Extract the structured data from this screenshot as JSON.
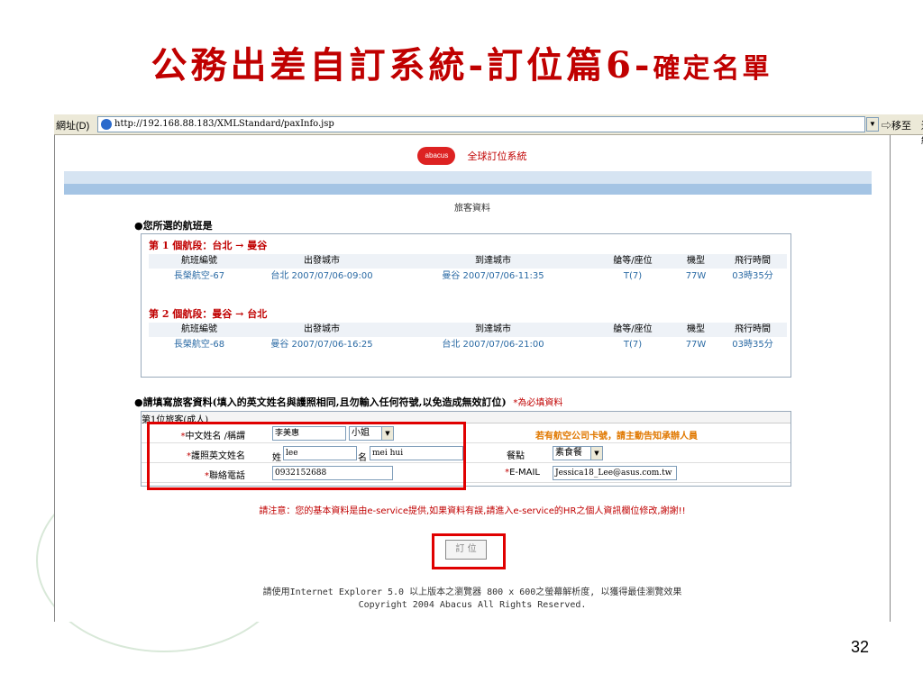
{
  "slide": {
    "title_main": "公務出差自訂系統-訂位篇6-",
    "title_sub": "確定名單",
    "page_number": "32"
  },
  "browser": {
    "address_label": "網址(D)",
    "url": "http://192.168.88.183/XMLStandard/paxInfo.jsp",
    "go_label": "移至",
    "links_label": "連結"
  },
  "header": {
    "logo_text": "abacus",
    "system_name": "全球訂位系統"
  },
  "page": {
    "heading": "旅客資料",
    "selected_flights_title": "●您所選的航班是"
  },
  "flights": {
    "columns": [
      "航班編號",
      "出發城市",
      "到達城市",
      "艙等/座位",
      "機型",
      "飛行時間"
    ],
    "legs": [
      {
        "title": "第 1 個航段：台北 → 曼谷",
        "row": [
          "長榮航空-67",
          "台北 2007/07/06-09:00",
          "曼谷 2007/07/06-11:35",
          "T(7)",
          "77W",
          "03時35分"
        ]
      },
      {
        "title": "第 2 個航段：曼谷 → 台北",
        "row": [
          "長榮航空-68",
          "曼谷 2007/07/06-16:25",
          "台北 2007/07/06-21:00",
          "T(7)",
          "77W",
          "03時35分"
        ]
      }
    ]
  },
  "form": {
    "title": "●請填寫旅客資料(填入的英文姓名與護照相同,且勿輸入任何符號,以免造成無效訂位)",
    "required_note": "*為必填資料",
    "pax_caption": "第1位旅客(成人)",
    "chinese_name_label": "中文姓名 /稱謂",
    "chinese_name_value": "李美惠",
    "title_select": "小姐",
    "airline_card_note": "若有航空公司卡號，請主動告知承辦人員",
    "passport_name_label": "護照英文姓名",
    "surname_label": "姓",
    "surname_value": "lee",
    "given_label": "名",
    "given_value": "mei hui",
    "meal_label": "餐點",
    "meal_select": "素食餐",
    "phone_label": "聯絡電話",
    "phone_value": "0932152688",
    "email_label": "E-MAIL",
    "email_value": "Jessica18_Lee@asus.com.tw",
    "star": "*"
  },
  "notice": "請注意：您的基本資料是由e-service提供,如果資料有誤,請進入e-service的HR之個人資訊欄位修改,謝謝!!",
  "book_button": "訂 位",
  "footer": {
    "line1": "請使用Internet Explorer 5.0 以上版本之瀏覽器 800 x 600之螢幕解析度, 以獲得最佳瀏覽效果",
    "line2": "Copyright 2004 Abacus All Rights Reserved."
  }
}
